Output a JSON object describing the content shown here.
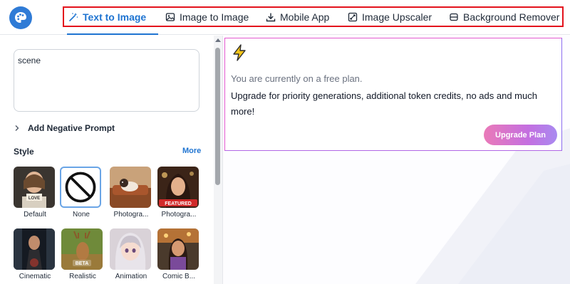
{
  "app": {
    "logo_icon": "palette-icon",
    "brand_color": "#2f7bd6"
  },
  "nav": {
    "tabs": [
      {
        "label": "Text to Image",
        "icon": "magic-wand-icon",
        "active": true
      },
      {
        "label": "Image to Image",
        "icon": "image-icon",
        "active": false
      },
      {
        "label": "Mobile App",
        "icon": "download-icon",
        "active": false
      },
      {
        "label": "Image Upscaler",
        "icon": "expand-icon",
        "active": false
      },
      {
        "label": "Background Remover",
        "icon": "layers-icon",
        "active": false
      }
    ],
    "accent_color": "#1f74d1",
    "highlight_border_color": "#e3131c"
  },
  "prompt": {
    "value": "scene"
  },
  "negative_prompt": {
    "label": "Add Negative Prompt"
  },
  "style": {
    "label": "Style",
    "more_label": "More",
    "items": [
      {
        "label": "Default",
        "badge": "LOVE"
      },
      {
        "label": "None",
        "icon": "no-style-icon",
        "selected": true
      },
      {
        "label": "Photogra..."
      },
      {
        "label": "Photogra...",
        "badge": "FEATURED"
      },
      {
        "label": "Cinematic"
      },
      {
        "label": "Realistic",
        "badge": "BETA"
      },
      {
        "label": "Animation"
      },
      {
        "label": "Comic B..."
      }
    ]
  },
  "promo": {
    "icon": "lightning-icon",
    "free_plan_text": "You are currently on a free plan.",
    "upgrade_text": "Upgrade for priority generations, additional token credits, no ads and much more!",
    "button_label": "Upgrade Plan"
  }
}
